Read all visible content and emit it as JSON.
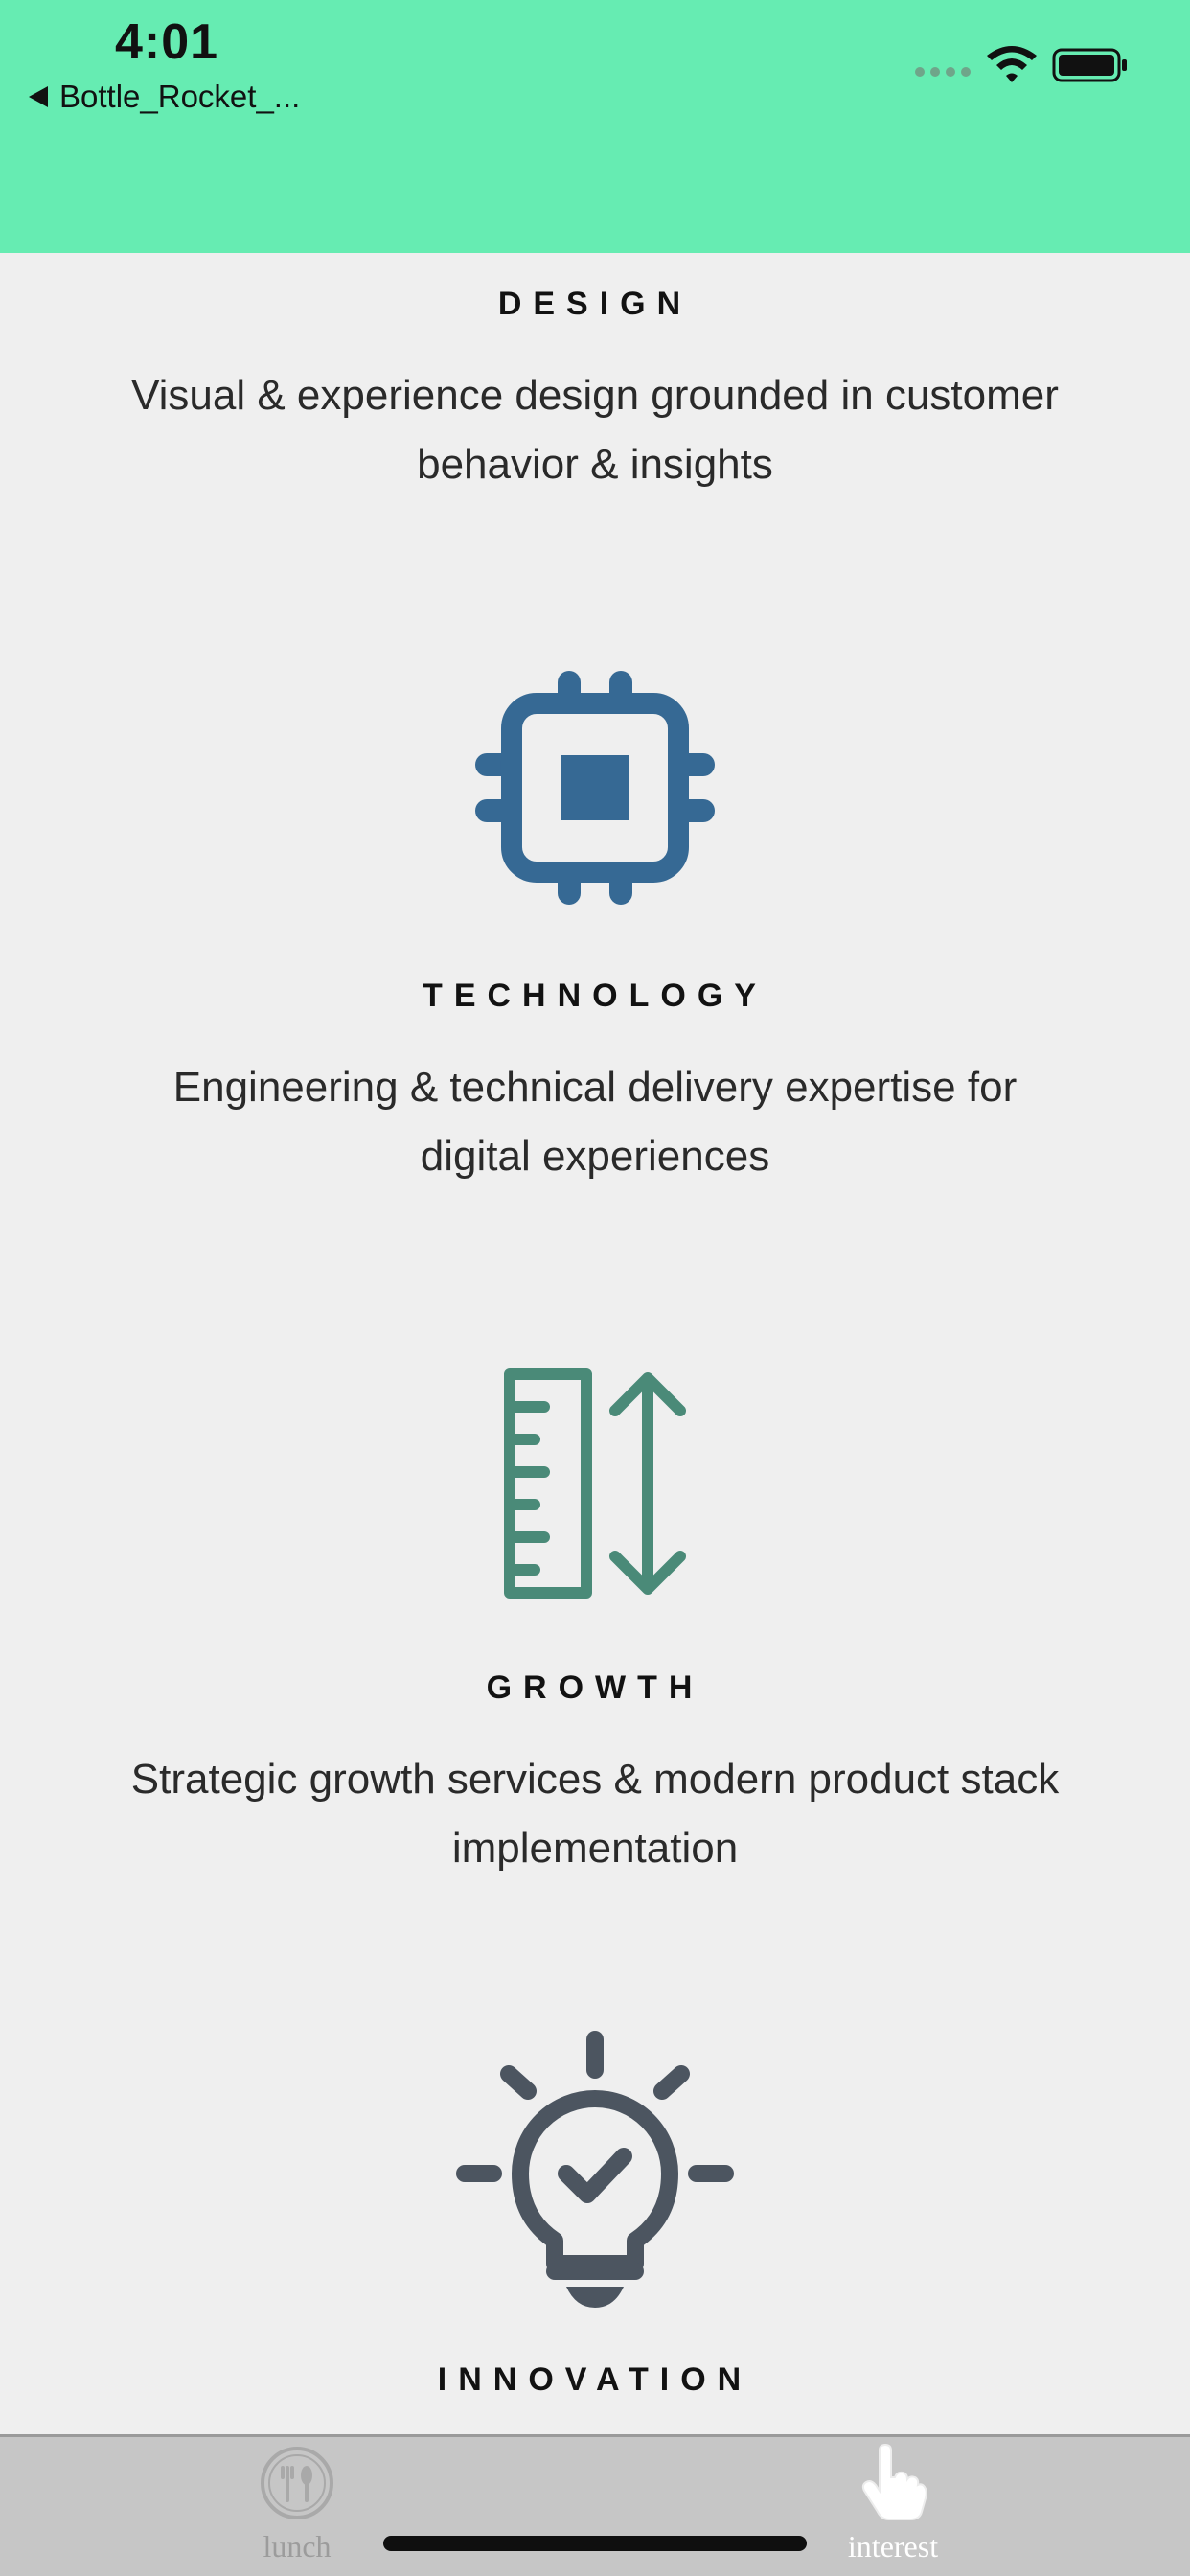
{
  "status_bar": {
    "time": "4:01",
    "back_label": "Bottle_Rocket_...",
    "background_color": "#66ecb2"
  },
  "sections": [
    {
      "heading": "DESIGN",
      "description": "Visual & experience design grounded in customer behavior & insights"
    },
    {
      "icon": "chip-icon",
      "icon_color": "#366994",
      "heading": "TECHNOLOGY",
      "description": "Engineering & technical delivery expertise for digital experiences"
    },
    {
      "icon": "ruler-arrow-icon",
      "icon_color": "#4a8a78",
      "heading": "GROWTH",
      "description": "Strategic growth services & modern product stack implementation"
    },
    {
      "icon": "lightbulb-check-icon",
      "icon_color": "#4c5560",
      "heading": "INNOVATION"
    }
  ],
  "tab_bar": {
    "tabs": [
      {
        "label": "lunch",
        "icon": "fork-spoon-icon",
        "selected": false
      },
      {
        "label": "interest",
        "icon": "hand-pointer-icon",
        "selected": true
      }
    ]
  }
}
